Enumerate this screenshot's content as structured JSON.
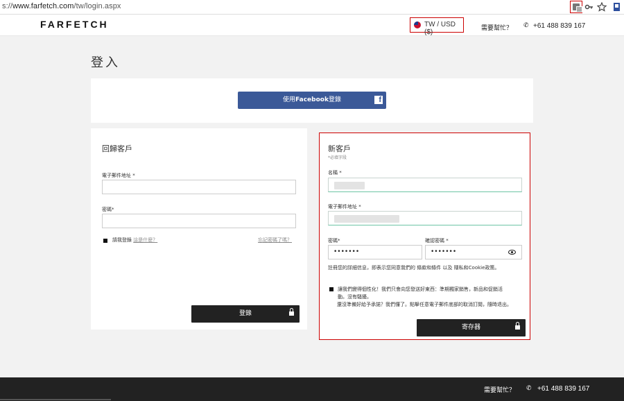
{
  "browser": {
    "url_prefix": "s://",
    "url_host": "www.farfetch.com",
    "url_path": "/tw/login.aspx",
    "icons": [
      "translate-icon",
      "key-icon",
      "star-icon",
      "extension-icon"
    ]
  },
  "header": {
    "logo": "FARFETCH",
    "locale": "TW / USD  ($)",
    "help": "需要幫忙？",
    "phone": "+61 488 839 167"
  },
  "page": {
    "title": "登入"
  },
  "facebook": {
    "prefix": "使用",
    "brand": "Facebook",
    "suffix": "登錄",
    "logo": "f"
  },
  "returning": {
    "title": "回歸客戶",
    "email_label": "電子郵件地址",
    "email_req": "*",
    "password_label": "密碼",
    "password_req": "*",
    "remember_label": "請我登錄",
    "remember_link": "這是什麼？",
    "forgot_link": "忘記密碼了嗎？",
    "login_button": "登錄"
  },
  "newcustomer": {
    "title": "新客戶",
    "required_note": "*必填字段",
    "name_label": "名稱",
    "name_req": "*",
    "email_label": "電子郵件地址",
    "email_req": "*",
    "password_label": "密碼",
    "password_req": "*",
    "password_value": "•••••••",
    "confirm_label": "確認密碼",
    "confirm_req": "*",
    "confirm_value": "•••••••",
    "terms": "註冊您的詳細信息，即表示您同意我們的 條款和條件 以及 隱私和Cookie政策。",
    "personalize_text_1": "讓我們變得個性化！我們只會向您發送好東西：準期獨家銷售，新品和促銷活",
    "personalize_text_2": "動。沒有騷擾。",
    "personalize_text_3": "還沒準備好給予承諾？我們懂了。點擊任意電子郵件底部的取消訂閱，隨時退出。",
    "register_button": "寄存器"
  },
  "footer": {
    "help": "需要幫忙？",
    "phone": "+61 488 839 167"
  }
}
